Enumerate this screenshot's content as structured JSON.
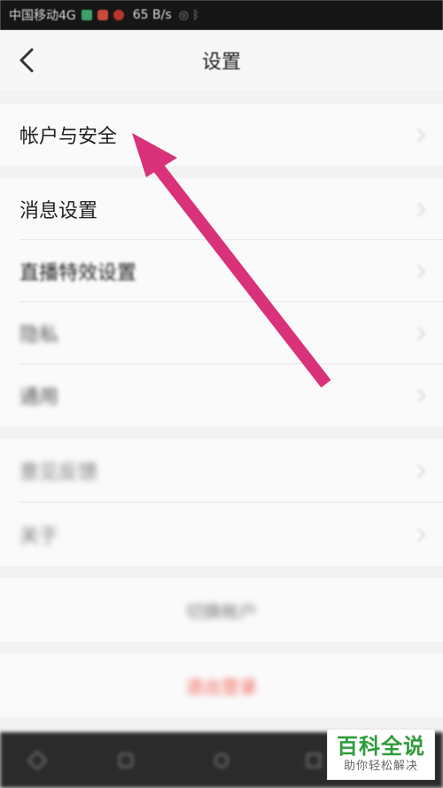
{
  "status_bar": {
    "carrier": "中国移动4G",
    "speed": "65 B/s",
    "extra": "◎ ᛒ"
  },
  "header": {
    "title": "设置"
  },
  "groups": [
    {
      "items": [
        {
          "label": "帐户与安全"
        }
      ]
    },
    {
      "items": [
        {
          "label": "消息设置"
        },
        {
          "label": "直播特效设置"
        },
        {
          "label": "隐私"
        },
        {
          "label": "通用"
        }
      ]
    },
    {
      "items": [
        {
          "label": "意见反馈"
        },
        {
          "label": "关于"
        }
      ]
    }
  ],
  "actions": {
    "switch_account": "切换帐户",
    "logout": "退出登录"
  },
  "watermark": {
    "title": "百科全说",
    "subtitle": "助你轻松解决"
  },
  "colors": {
    "arrow": "#d9317a",
    "logout": "#f06050",
    "watermark_green": "#2e9c3a"
  }
}
